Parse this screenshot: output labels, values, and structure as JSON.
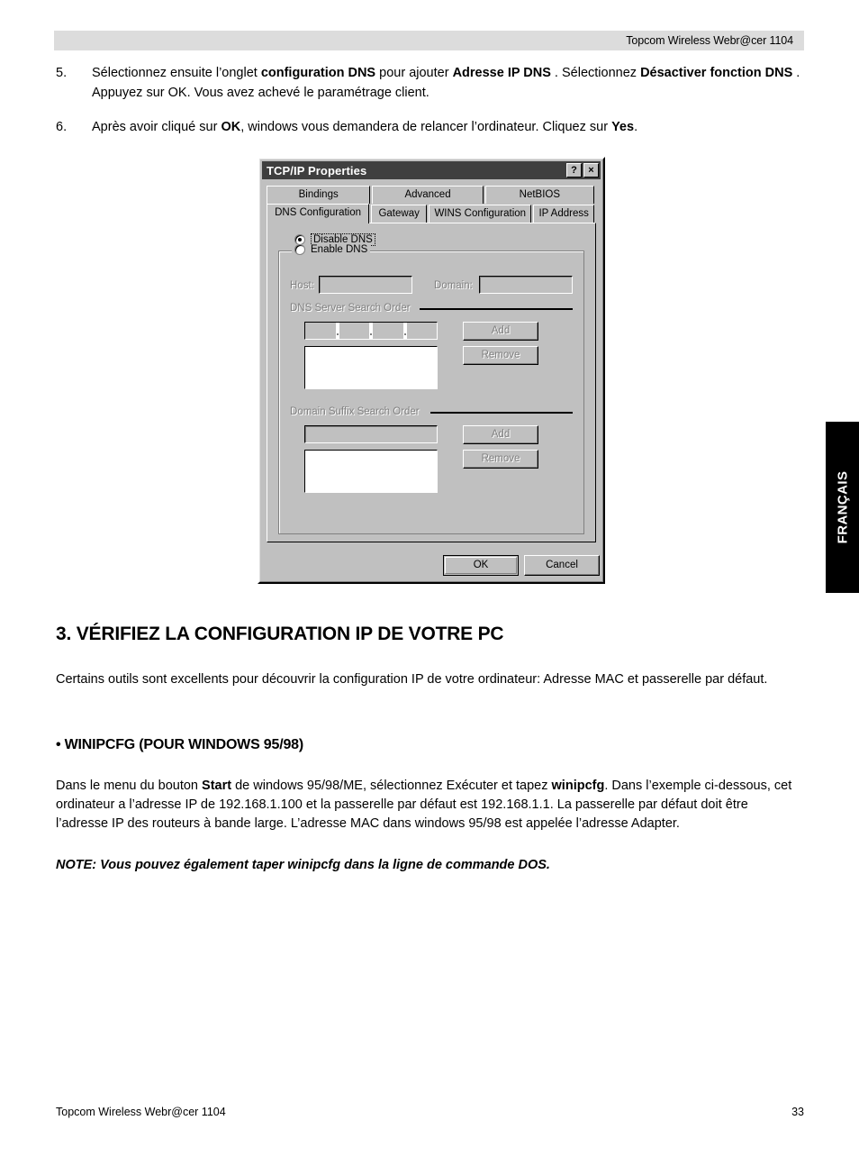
{
  "header": {
    "title": "Topcom Wireless Webr@cer 1104"
  },
  "steps": [
    {
      "num": "5.",
      "parts": [
        {
          "t": "Sélectionnez ensuite l’onglet  ",
          "b": false
        },
        {
          "t": "configuration DNS",
          "b": true
        },
        {
          "t": "  pour ajouter ",
          "b": false
        },
        {
          "t": "Adresse IP DNS",
          "b": true
        },
        {
          "t": " . Sélectionnez ",
          "b": false
        },
        {
          "t": "Désactiver fonction DNS",
          "b": true
        },
        {
          "t": " . Appuyez sur OK.  Vous avez achevé le paramétrage client.",
          "b": false
        }
      ]
    },
    {
      "num": "6.",
      "parts": [
        {
          "t": "Après avoir cliqué sur ",
          "b": false
        },
        {
          "t": "OK",
          "b": true
        },
        {
          "t": ", windows vous demandera de relancer l’ordinateur. Cliquez sur ",
          "b": false
        },
        {
          "t": "Yes",
          "b": true
        },
        {
          "t": ".",
          "b": false
        }
      ]
    }
  ],
  "dialog": {
    "title": "TCP/IP Properties",
    "help_button": "?",
    "close_button": "×",
    "tabs_row1": [
      "Bindings",
      "Advanced",
      "NetBIOS"
    ],
    "tabs_row2": [
      "DNS Configuration",
      "Gateway",
      "WINS Configuration",
      "IP Address"
    ],
    "active_tab": "DNS Configuration",
    "radio_disable": "Disable DNS",
    "radio_enable": "Enable DNS",
    "selected_radio": "Disable DNS",
    "label_host": "Host:",
    "label_domain": "Domain:",
    "value_host": "",
    "value_domain": "",
    "group_dns_order": "DNS Server Search Order",
    "group_suffix_order": "Domain Suffix Search Order",
    "value_dns_ip": "",
    "value_suffix": "",
    "btn_add_1": "Add",
    "btn_remove_1": "Remove",
    "btn_add_2": "Add",
    "btn_remove_2": "Remove",
    "btn_ok": "OK",
    "btn_cancel": "Cancel"
  },
  "section": {
    "title": "3.  VÉRIFIEZ LA CONFIGURATION IP  DE VOTRE PC",
    "intro": "Certains outils sont excellents pour découvrir la configuration IP de votre ordinateur: Adresse MAC et passerelle par défaut.",
    "sub_title": "• WINIPCFG (POUR WINDOWS 95/98)",
    "body_parts": [
      {
        "t": "Dans le menu du bouton ",
        "b": false
      },
      {
        "t": "Start",
        "b": true
      },
      {
        "t": " de windows 95/98/ME, sélectionnez Exécuter et tapez ",
        "b": false
      },
      {
        "t": "winipcfg",
        "b": true
      },
      {
        "t": ". Dans l’exemple ci-dessous, cet ordinateur a l’adresse IP de 192.168.1.100 et la passerelle par défaut est 192.168.1.1.  La passerelle par défaut doit être l’adresse IP des routeurs à bande large. L’adresse MAC dans windows 95/98 est appelée l’adresse Adapter.",
        "b": false
      }
    ],
    "note": "NOTE: Vous pouvez également taper winipcfg dans la ligne de commande DOS."
  },
  "sidetab": {
    "label": "FRANÇAIS"
  },
  "footer": {
    "left": "Topcom Wireless Webr@cer 1104",
    "page": "33"
  }
}
